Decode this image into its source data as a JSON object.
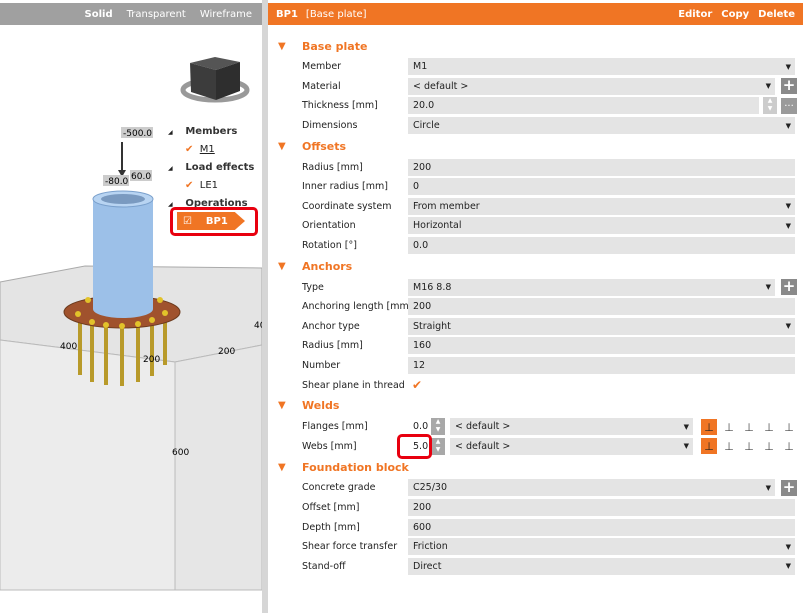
{
  "viewport": {
    "modes": [
      "Solid",
      "Transparent",
      "Wireframe"
    ],
    "active": "Solid"
  },
  "tree": {
    "members": "Members",
    "m1": "M1",
    "load_effects": "Load effects",
    "le1": "LE1",
    "operations": "Operations",
    "bp1": "BP1"
  },
  "scene": {
    "load_fz": "-500.0",
    "load_a": "-80.0",
    "load_b": "60.0",
    "dim_400": "400",
    "dim_200a": "200",
    "dim_200b": "200",
    "dim_600": "600",
    "dim_40": "40"
  },
  "header": {
    "name": "BP1",
    "type": "[Base plate]",
    "editor": "Editor",
    "copy": "Copy",
    "delete": "Delete"
  },
  "accent": "#f07524",
  "sections": {
    "base_plate": {
      "title": "Base plate",
      "member_l": "Member",
      "member": "M1",
      "material_l": "Material",
      "material": "< default >",
      "thickness_l": "Thickness [mm]",
      "thickness": "20.0",
      "dimensions_l": "Dimensions",
      "dimensions": "Circle",
      "more": "..."
    },
    "offsets": {
      "title": "Offsets",
      "radius_l": "Radius [mm]",
      "radius": "200",
      "inner_l": "Inner radius [mm]",
      "inner": "0",
      "coord_l": "Coordinate system",
      "coord": "From member",
      "orient_l": "Orientation",
      "orient": "Horizontal",
      "rot_l": "Rotation [°]",
      "rot": "0.0"
    },
    "anchors": {
      "title": "Anchors",
      "type_l": "Type",
      "type": "M16 8.8",
      "len_l": "Anchoring length [mm]",
      "len": "200",
      "atype_l": "Anchor type",
      "atype": "Straight",
      "radius_l": "Radius [mm]",
      "radius": "160",
      "number_l": "Number",
      "number": "12",
      "shear_l": "Shear plane in thread",
      "shear": true
    },
    "welds": {
      "title": "Welds",
      "flanges_l": "Flanges [mm]",
      "flanges": "0.0",
      "flanges_mat": "< default >",
      "webs_l": "Webs [mm]",
      "webs": "5.0",
      "webs_mat": "< default >"
    },
    "foundation": {
      "title": "Foundation block",
      "grade_l": "Concrete grade",
      "grade": "C25/30",
      "offset_l": "Offset [mm]",
      "offset": "200",
      "depth_l": "Depth [mm]",
      "depth": "600",
      "sft_l": "Shear force transfer",
      "sft": "Friction",
      "standoff_l": "Stand-off",
      "standoff": "Direct"
    }
  }
}
